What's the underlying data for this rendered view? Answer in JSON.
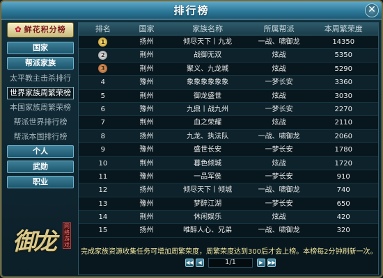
{
  "window": {
    "title": "排行榜",
    "close_label": "✕"
  },
  "sidebar": {
    "badge_label": "鲜花积分榜",
    "items": [
      {
        "label": "国家",
        "type": "button"
      },
      {
        "label": "帮派家族",
        "type": "button"
      },
      {
        "label": "太平教主击杀排行",
        "type": "sub"
      },
      {
        "label": "世界家族周繁荣榜",
        "type": "sub",
        "active": true
      },
      {
        "label": "本国家族周繁荣榜",
        "type": "sub"
      },
      {
        "label": "帮派世界排行榜",
        "type": "sub"
      },
      {
        "label": "帮派本国排行榜",
        "type": "sub"
      },
      {
        "label": "个人",
        "type": "button"
      },
      {
        "label": "武勋",
        "type": "button"
      },
      {
        "label": "职业",
        "type": "button"
      }
    ],
    "logo_text": "御龙",
    "logo_tag": "网络游戏"
  },
  "table": {
    "headers": [
      "排名",
      "国家",
      "家族名称",
      "所属帮派",
      "本周繁荣度"
    ],
    "rows": [
      {
        "rank": "1",
        "country": "扬州",
        "family": "倾尽天下丨九龙",
        "faction": "一战、啸御龙",
        "score": "14350"
      },
      {
        "rank": "2",
        "country": "荆州",
        "family": "战御无双",
        "faction": "炫战",
        "score": "5350"
      },
      {
        "rank": "3",
        "country": "荆州",
        "family": "聚义、九龙城",
        "faction": "炫战",
        "score": "5290"
      },
      {
        "rank": "4",
        "country": "豫州",
        "family": "象象象象象象",
        "faction": "一梦长安",
        "score": "3360"
      },
      {
        "rank": "5",
        "country": "荆州",
        "family": "御龙盛世",
        "faction": "炫战",
        "score": "3030"
      },
      {
        "rank": "6",
        "country": "豫州",
        "family": "九鼎丨战九州",
        "faction": "一梦长安",
        "score": "2270"
      },
      {
        "rank": "7",
        "country": "荆州",
        "family": "血之荣耀",
        "faction": "炫战",
        "score": "2110"
      },
      {
        "rank": "8",
        "country": "扬州",
        "family": "九龙、执法队",
        "faction": "一战、啸御龙",
        "score": "2060"
      },
      {
        "rank": "9",
        "country": "豫州",
        "family": "盛世长安",
        "faction": "一梦长安",
        "score": "1780"
      },
      {
        "rank": "10",
        "country": "荆州",
        "family": "暮色倾城",
        "faction": "炫战",
        "score": "1720"
      },
      {
        "rank": "11",
        "country": "豫州",
        "family": "一品军侯",
        "faction": "一梦长安",
        "score": "910"
      },
      {
        "rank": "12",
        "country": "扬州",
        "family": "倾尽天下丨倾城",
        "faction": "一战、啸御龙",
        "score": "740"
      },
      {
        "rank": "13",
        "country": "豫州",
        "family": "梦醉江湖",
        "faction": "一梦长安",
        "score": "650"
      },
      {
        "rank": "14",
        "country": "荆州",
        "family": "休闲娱乐",
        "faction": "炫战",
        "score": "420"
      },
      {
        "rank": "15",
        "country": "扬州",
        "family": "唯醉人心、兄弟",
        "faction": "一战、啸御龙",
        "score": "320"
      }
    ]
  },
  "notice": "完成家族资源收集任务可增加周繁荣度，周繁荣度达到300后才会上榜。本榜每2分钟刷新一次。",
  "pager": {
    "first": "◀◀",
    "prev": "◀",
    "current": "1/1",
    "next": "▶",
    "last": "▶▶"
  },
  "colors": {
    "accent": "#2e7a9b",
    "notice": "#f2e7a0",
    "gold": "#b88a1c"
  }
}
